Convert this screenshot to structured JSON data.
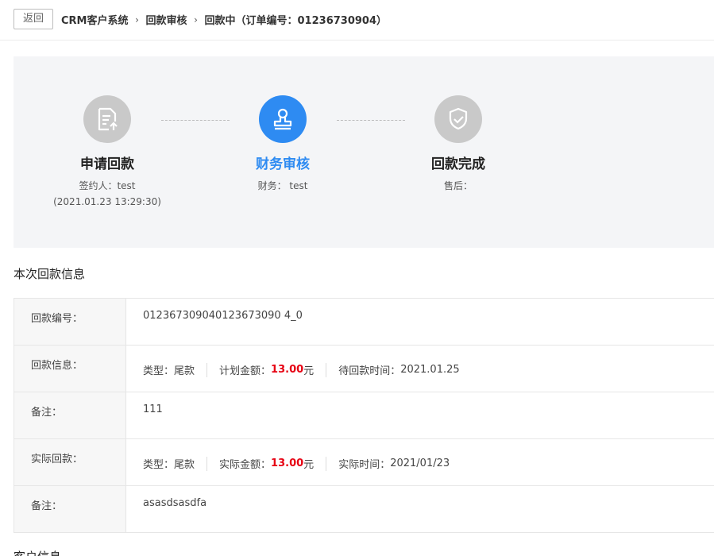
{
  "header": {
    "back_label": "返回",
    "breadcrumbs": [
      "CRM客户系统",
      "回款审核",
      "回款中（订单编号：01236730904）"
    ]
  },
  "steps": [
    {
      "title": "申请回款",
      "icon": "document-upload-icon",
      "lines": [
        "签约人：test",
        "(2021.01.23 13:29:30)"
      ],
      "state": "done"
    },
    {
      "title": "财务审核",
      "icon": "stamp-icon",
      "lines": [
        "财务： test"
      ],
      "state": "active"
    },
    {
      "title": "回款完成",
      "icon": "shield-check-icon",
      "lines": [
        "售后："
      ],
      "state": "pending"
    }
  ],
  "payment_section": {
    "title": "本次回款信息",
    "rows": {
      "number": {
        "label": "回款编号：",
        "value": "012367309040123673090 4_0"
      },
      "info": {
        "label": "回款信息：",
        "type_label": "类型：",
        "type_value": "尾款",
        "amount_label": "计划金额：",
        "amount_value": "13.00",
        "amount_unit": "元",
        "time_label": "待回款时间：",
        "time_value": "2021.01.25"
      },
      "note1": {
        "label": "备注：",
        "value": "111"
      },
      "actual": {
        "label": "实际回款：",
        "type_label": "类型：",
        "type_value": "尾款",
        "amount_label": "实际金额：",
        "amount_value": "13.00",
        "amount_unit": "元",
        "time_label": "实际时间：",
        "time_value": "2021/01/23"
      },
      "note2": {
        "label": "备注：",
        "value": "asasdsasdfa"
      }
    }
  },
  "customer_section": {
    "title": "客户信息"
  },
  "colors": {
    "accent": "#2e8bf2",
    "amount_red": "#e60012",
    "step_inactive": "#c9c9c9"
  }
}
